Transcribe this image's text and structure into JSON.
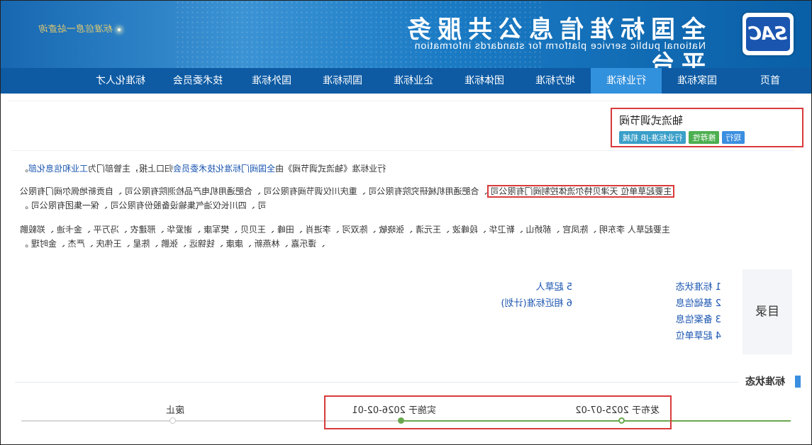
{
  "header": {
    "logo_text": "SAC",
    "title_cn": "全国标准信息公共服务平台",
    "title_en": "National public service platform  for standards information",
    "slogan": "标准信息一站查询"
  },
  "nav": {
    "items": [
      "首页",
      "国家标准",
      "行业标准",
      "地方标准",
      "团体标准",
      "企业标准",
      "国际标准",
      "国外标准",
      "技术委员会",
      "标准化人才"
    ],
    "active_index": 2
  },
  "standard": {
    "name": "轴流式调节阀",
    "badges": [
      {
        "label": "行业标准-JB 机械",
        "color": "#3a9fc9"
      },
      {
        "label": "推荐性",
        "color": "#4caf50"
      },
      {
        "label": "现行",
        "color": "#3b8fe0"
      }
    ]
  },
  "intro": {
    "text_1": "行业标准《轴流式调节阀》由",
    "link": "全国阀门标准化技术委员会",
    "text_2": "归口上报，主管部门为",
    "dept": "工业和信息化部",
    "end": "。"
  },
  "drafting_units": {
    "label": "主要起草单位",
    "first": "天津贝特尔流体控制阀门有限公司",
    "rest_line1": "、合肥通用机械研究院有限公司 、重庆川仪调节阀有限公司 、合肥通用机电产品检测院有限公司 、自贡新地佩尔阀门有限公",
    "rest_line2": "司 、四川长仪油气集输设备股份有限公司 、保一集团有限公司 。"
  },
  "drafters": {
    "line1": "主要起草人 李东明 、陈凤官 、郝娇山 、靳卫华 、段峰波 、王元清 、张晓敏 、陈双河 、李进肖 、田峰 、王贝贝 、樊军康 、谢爱华 、邢建农 、冯万平 、金卡迪 、郑毅鹏",
    "line2": "、谭乐嘉 、林燕新 、康康 、钱锦远 、张鹏 、陈星 、王伟庆 、严杰 、金时理 。"
  },
  "toc": {
    "label": "目录",
    "items": [
      "1 标准状态",
      "2 基础信息",
      "3 备案信息",
      "4 起草单位",
      "5 起草人",
      "6 相近标准(计划)"
    ]
  },
  "status": {
    "title": "标准状态",
    "published": "发布于 2025-07-02",
    "implemented": "实施于 2026-02-01",
    "abolished": "废止"
  }
}
